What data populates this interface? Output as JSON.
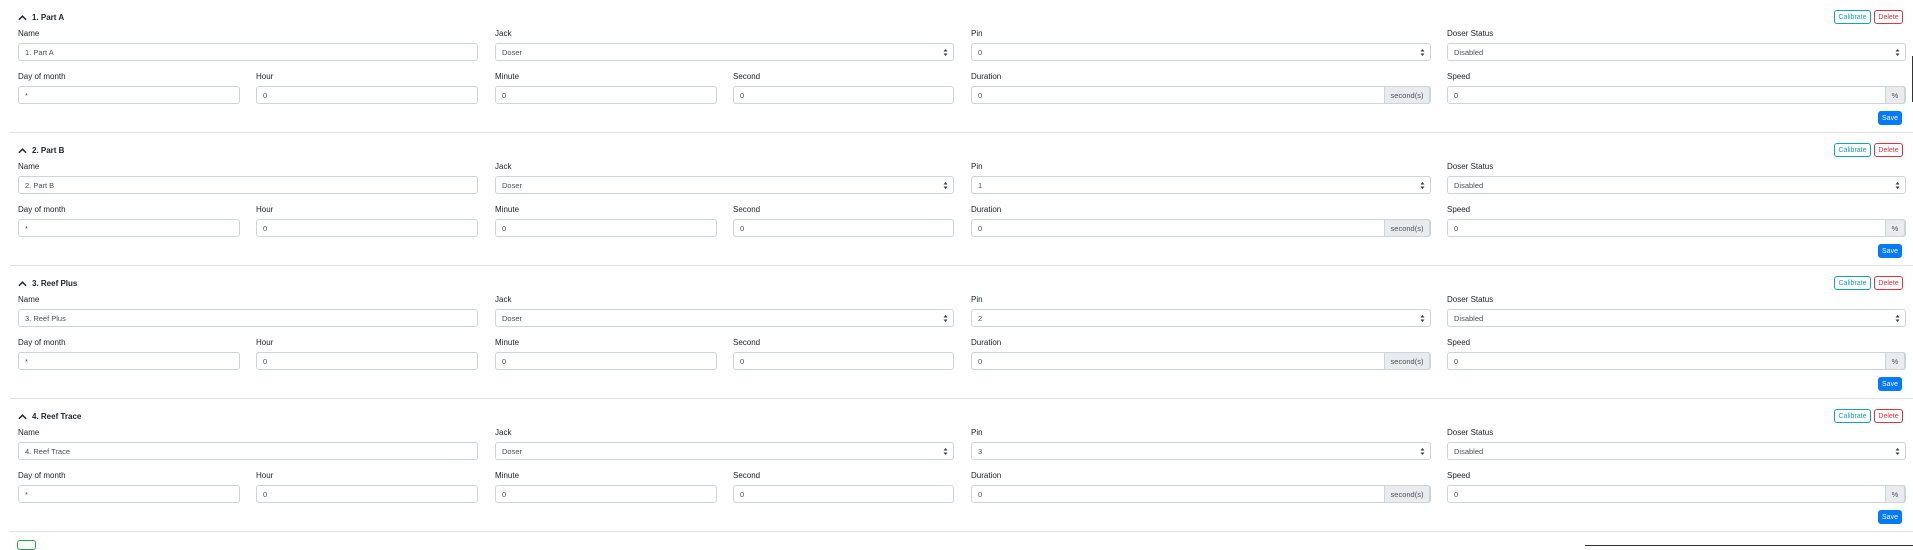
{
  "labels": {
    "name": "Name",
    "jack": "Jack",
    "pin": "Pin",
    "doser_status": "Doser Status",
    "day_of_month": "Day of month",
    "hour": "Hour",
    "minute": "Minute",
    "second": "Second",
    "duration": "Duration",
    "speed": "Speed"
  },
  "buttons": {
    "calibrate": "Calibrate",
    "delete": "Delete",
    "save": "Save"
  },
  "units": {
    "duration": "second(s)",
    "speed": "%"
  },
  "icons": {
    "collapse": "chevron-up-icon",
    "select": "select-arrows-icon",
    "add": "add-icon"
  },
  "colors": {
    "calibrate": "#17a2b8",
    "delete": "#dc3545",
    "save": "#007bff",
    "add": "#28a745"
  },
  "dosers": [
    {
      "title": "1. Part A",
      "name": "1. Part A",
      "jack": "Doser",
      "pin": "0",
      "status": "Disabled",
      "day_of_month": "*",
      "hour": "0",
      "minute": "0",
      "second": "0",
      "duration": "0",
      "speed": "0"
    },
    {
      "title": "2. Part B",
      "name": "2. Part B",
      "jack": "Doser",
      "pin": "1",
      "status": "Disabled",
      "day_of_month": "*",
      "hour": "0",
      "minute": "0",
      "second": "0",
      "duration": "0",
      "speed": "0"
    },
    {
      "title": "3. Reef Plus",
      "name": "3. Reef Plus",
      "jack": "Doser",
      "pin": "2",
      "status": "Disabled",
      "day_of_month": "*",
      "hour": "0",
      "minute": "0",
      "second": "0",
      "duration": "0",
      "speed": "0"
    },
    {
      "title": "4. Reef Trace",
      "name": "4. Reef Trace",
      "jack": "Doser",
      "pin": "3",
      "status": "Disabled",
      "day_of_month": "*",
      "hour": "0",
      "minute": "0",
      "second": "0",
      "duration": "0",
      "speed": "0"
    }
  ]
}
